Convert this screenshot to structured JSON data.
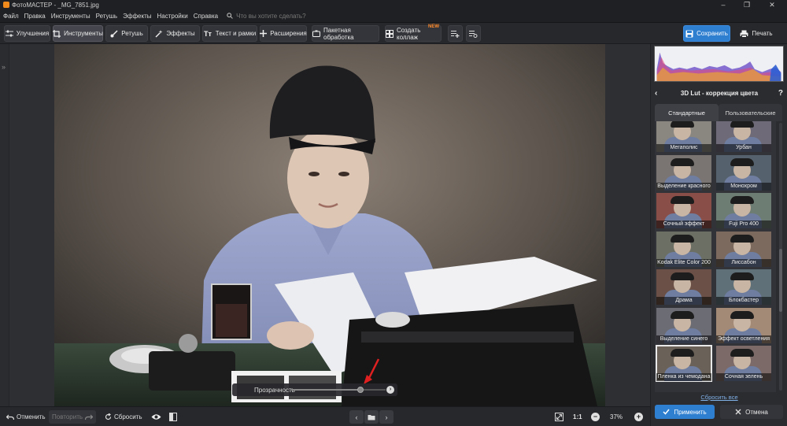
{
  "window": {
    "title": "ФотоМАСТЕР - _MG_7851.jpg",
    "controls": [
      "–",
      "❐",
      "✕"
    ]
  },
  "menu": {
    "items": [
      "Файл",
      "Правка",
      "Инструменты",
      "Ретушь",
      "Эффекты",
      "Настройки",
      "Справка"
    ],
    "search_placeholder": "Что вы хотите сделать?"
  },
  "toolbar": {
    "improve": "Улучшения",
    "tools": "Инструменты",
    "retouch": "Ретушь",
    "effects": "Эффекты",
    "text": "Текст и рамки",
    "extensions": "Расширения",
    "batch": "Пакетная обработка",
    "collage": "Создать коллаж",
    "new_badge": "NEW",
    "save": "Сохранить",
    "print": "Печать",
    "active_tab": "Инструменты"
  },
  "panel": {
    "title": "3D Lut - коррекция цвета",
    "help": "?",
    "tabs": [
      "Стандартные",
      "Пользовательские"
    ],
    "active_tab": "Стандартные",
    "presets": [
      {
        "label": "Мегаполис",
        "tone": "#8a8780"
      },
      {
        "label": "Урбан",
        "tone": "#6f6a78"
      },
      {
        "label": "Выделение красного",
        "tone": "#7a7572"
      },
      {
        "label": "Монохром",
        "tone": "#55626e"
      },
      {
        "label": "Сочный эффект",
        "tone": "#8a4e48"
      },
      {
        "label": "Fuji Pro 400",
        "tone": "#6e7d73"
      },
      {
        "label": "Kodak Elite Color 200",
        "tone": "#6b6f64"
      },
      {
        "label": "Лиссабон",
        "tone": "#7b6a5d"
      },
      {
        "label": "Драма",
        "tone": "#6a5046"
      },
      {
        "label": "Блокбастер",
        "tone": "#5f7079"
      },
      {
        "label": "Выделение синего",
        "tone": "#6c6c74"
      },
      {
        "label": "Эффект осветления",
        "tone": "#a38a77"
      },
      {
        "label": "Пленка из чемодана",
        "tone": "#6a6258"
      },
      {
        "label": "Сочная зелень",
        "tone": "#7b6a68"
      }
    ],
    "selected_preset": "Пленка из чемодана",
    "reset_all": "Сбросить все",
    "apply": "Применить",
    "cancel": "Отмена"
  },
  "opacity": {
    "label": "Прозрачность",
    "value_fraction": 0.73
  },
  "bottombar": {
    "undo": "Отменить",
    "redo": "Повторить",
    "reset": "Сбросить",
    "ratio": "1:1",
    "zoom": "37%"
  },
  "colors": {
    "accent": "#2f7fd1",
    "new_badge": "#ff8a2a"
  }
}
